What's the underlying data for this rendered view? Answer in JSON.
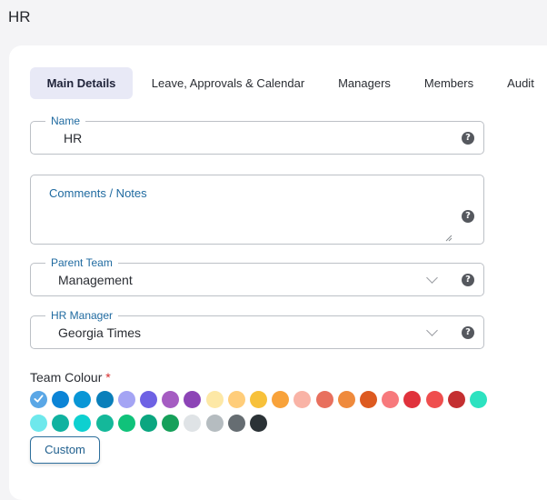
{
  "page": {
    "title": "HR"
  },
  "tabs": [
    {
      "label": "Main Details",
      "active": true
    },
    {
      "label": "Leave, Approvals & Calendar",
      "active": false
    },
    {
      "label": "Managers",
      "active": false
    },
    {
      "label": "Members",
      "active": false
    },
    {
      "label": "Audit",
      "active": false
    }
  ],
  "fields": {
    "name": {
      "label": "Name",
      "value": "HR"
    },
    "notes": {
      "label": "Comments / Notes",
      "value": ""
    },
    "parent_team": {
      "label": "Parent Team",
      "value": "Management"
    },
    "hr_manager": {
      "label": "HR Manager",
      "value": "Georgia Times"
    }
  },
  "help_glyph": "?",
  "team_colour": {
    "label": "Team Colour",
    "required_mark": "*",
    "selected_index": 0,
    "swatches": [
      "#5aa7e6",
      "#0b84d6",
      "#0996d6",
      "#0a7fba",
      "#a4a4f4",
      "#6e62e4",
      "#a55cc2",
      "#8c44b6",
      "#fde8a6",
      "#ffcd7a",
      "#f7c13a",
      "#f8a23a",
      "#f9b3a6",
      "#e8705e",
      "#ef8a3c",
      "#dd5a20",
      "#f7797c",
      "#e0323c",
      "#ef4e4e",
      "#c42f31",
      "#2de2c0",
      "#6ee8ec",
      "#10b2a0",
      "#0ed0d0",
      "#14b89a",
      "#10c27a",
      "#0ba680",
      "#16a05a",
      "#dfe3e6",
      "#b5bcc0",
      "#666d72",
      "#2b3236"
    ],
    "custom_label": "Custom"
  }
}
